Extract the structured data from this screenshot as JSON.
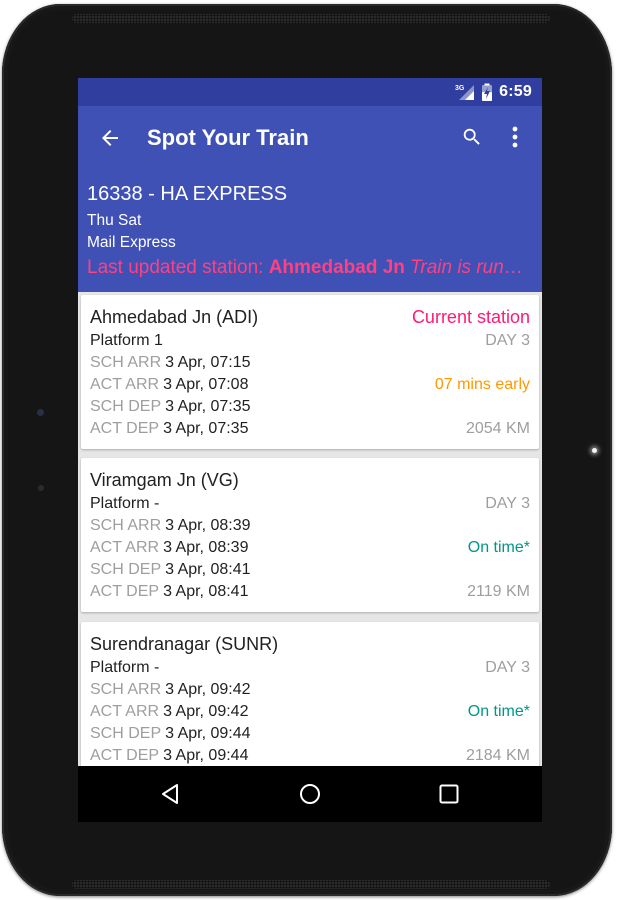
{
  "status_bar": {
    "network": "3G",
    "time": "6:59"
  },
  "toolbar": {
    "title": "Spot Your Train",
    "back_icon": "arrow-back-icon",
    "search_icon": "search-icon",
    "more_icon": "more-vert-icon"
  },
  "train": {
    "name": "16338 - HA EXPRESS",
    "days": "Thu Sat",
    "type": "Mail Express",
    "last_updated_prefix": "Last updated station: ",
    "last_updated_station": "Ahmedabad Jn",
    "last_updated_suffix": " Train is running..."
  },
  "labels": {
    "sch_arr": "SCH ARR",
    "act_arr": "ACT ARR",
    "sch_dep": "SCH DEP",
    "act_dep": "ACT DEP"
  },
  "colors": {
    "primary": "#3f51b5",
    "primary_dark": "#303f9f",
    "accent": "#ff4081",
    "current_station": "#ff1a75",
    "early": "#ff9800",
    "on_time": "#009688"
  },
  "stations": [
    {
      "name": "Ahmedabad Jn (ADI)",
      "status": "Current station",
      "platform": "Platform  1",
      "day": "DAY 3",
      "sch_arr": "3 Apr, 07:15",
      "act_arr": "3 Apr, 07:08",
      "delay": "07 mins early",
      "sch_dep": "3 Apr, 07:35",
      "act_dep": "3 Apr, 07:35",
      "distance": "2054 KM"
    },
    {
      "name": "Viramgam Jn (VG)",
      "status": "",
      "platform": "Platform  -",
      "day": "DAY 3",
      "sch_arr": "3 Apr, 08:39",
      "act_arr": "3 Apr, 08:39",
      "delay": "On time*",
      "sch_dep": "3 Apr, 08:41",
      "act_dep": "3 Apr, 08:41",
      "distance": "2119 KM"
    },
    {
      "name": "Surendranagar (SUNR)",
      "status": "",
      "platform": "Platform  -",
      "day": "DAY 3",
      "sch_arr": "3 Apr, 09:42",
      "act_arr": "3 Apr, 09:42",
      "delay": "On time*",
      "sch_dep": "3 Apr, 09:44",
      "act_dep": "3 Apr, 09:44",
      "distance": "2184 KM"
    }
  ],
  "nav_bar": {
    "back": "nav-back-icon",
    "home": "nav-home-icon",
    "recents": "nav-recents-icon"
  }
}
